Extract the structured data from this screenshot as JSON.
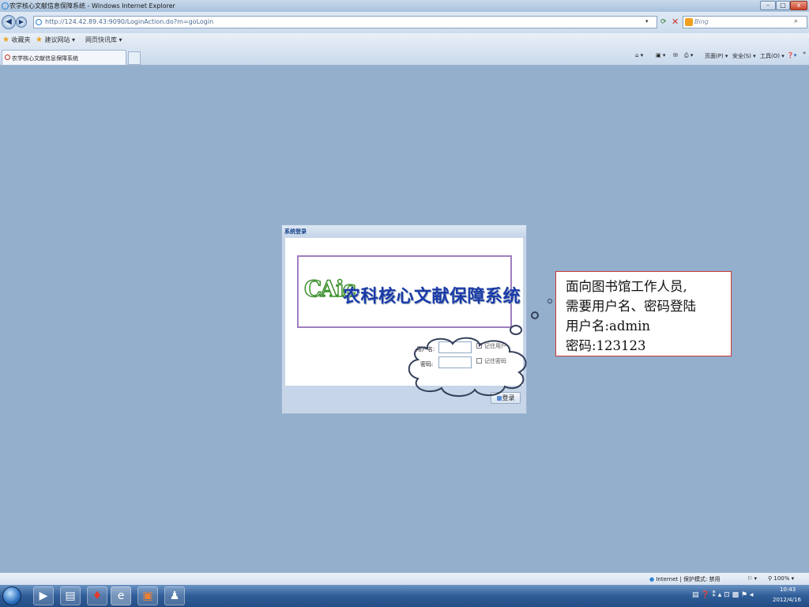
{
  "window": {
    "title": "农学核心文献信息保障系统 - Windows Internet Explorer",
    "minimize": "–",
    "maximize": "□",
    "close": "x"
  },
  "browser": {
    "address": "http://124.42.89.43:9090/LoginAction.do?m=goLogin",
    "search_placeholder": "Bing",
    "favorites_label": "收藏夹",
    "favorites_items": [
      "建议网站 ▾",
      "网页快讯库 ▾"
    ],
    "tab_title": "农学核心文献信息保障系统",
    "commands": {
      "page": "页面(P) ▾",
      "safety": "安全(S) ▾",
      "tools": "工具(O) ▾"
    }
  },
  "login": {
    "panel_title": "系统登录",
    "logo_mark": "CAic",
    "logo_text": "农科核心文献保障系统",
    "username_label": "用户名:",
    "password_label": "密码:",
    "remember_user": "记住用户",
    "remember_password": "记住密码",
    "submit": "登录"
  },
  "callout": {
    "lines": [
      "面向图书馆工作人员,",
      "需要用户名、密码登陆",
      "用户名:admin",
      "密码:123123"
    ]
  },
  "status": {
    "zone": "Internet | 保护模式: 禁用",
    "zoom": "100%"
  },
  "taskbar": {
    "time": "10:43",
    "date": "2012/4/16"
  }
}
